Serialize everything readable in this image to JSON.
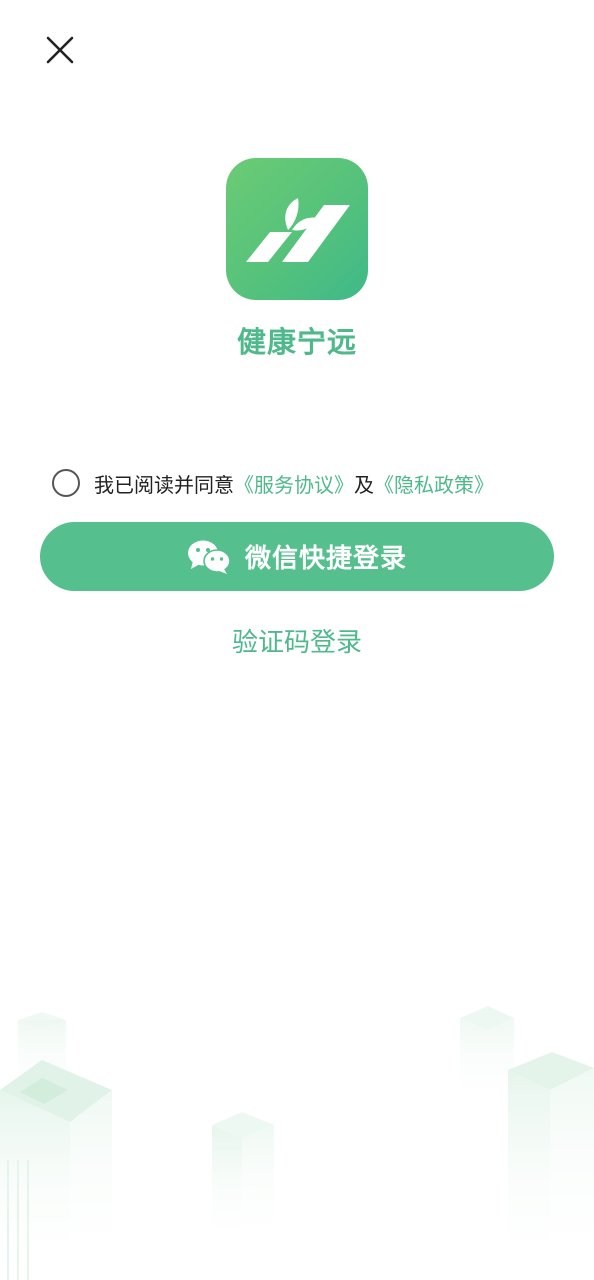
{
  "header": {
    "close_icon": "close-icon"
  },
  "app": {
    "logo_icon": "leaf-logo-icon",
    "name": "健康宁远",
    "brand_color": "#55bf8e"
  },
  "agreement": {
    "checked": false,
    "prefix": "我已阅读并同意",
    "service_link": "《服务协议》",
    "conjunction": "及",
    "privacy_link": "《隐私政策》"
  },
  "actions": {
    "wechat_icon": "wechat-icon",
    "wechat_login_label": "微信快捷登录",
    "sms_login_label": "验证码登录"
  }
}
